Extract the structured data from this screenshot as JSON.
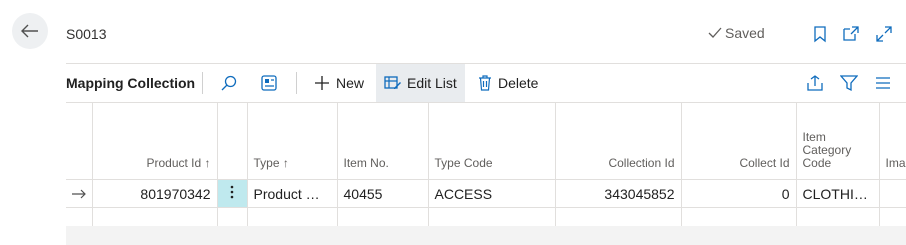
{
  "header": {
    "title": "S0013",
    "saved": "Saved"
  },
  "actionbar": {
    "part_title": "Mapping Collection",
    "new_label": "New",
    "edit_list_label": "Edit List",
    "delete_label": "Delete"
  },
  "table": {
    "columns": [
      "Product Id ↑",
      "Type ↑",
      "Item No.",
      "Type Code",
      "Collection Id",
      "Collect Id",
      "Item Category Code",
      "Image"
    ],
    "rows": [
      {
        "product_id": "801970342",
        "type": "Product Gr...",
        "item_no": "40455",
        "type_code": "ACCESS",
        "collection_id": "343045852",
        "collect_id": "0",
        "item_category_code": "CLOTHING",
        "image": ""
      }
    ]
  },
  "colors": {
    "accent": "#0f6cbd",
    "selected_cell": "#bfe9ee"
  }
}
